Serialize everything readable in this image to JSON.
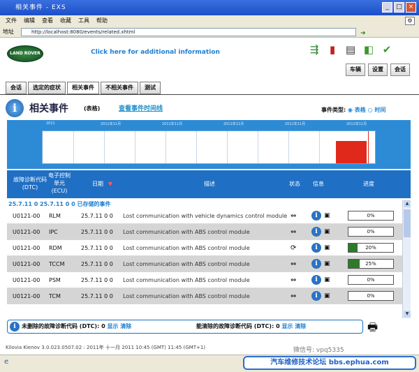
{
  "window": {
    "title": "相关事件 - EXS"
  },
  "menubar": {
    "items": [
      "文件",
      "编辑",
      "查看",
      "收藏",
      "工具",
      "帮助"
    ]
  },
  "address": {
    "label": "地址",
    "url": "http://localhost:8080/events/related.xhtml"
  },
  "header": {
    "logo_text": "LAND ROVER",
    "info_link": "Click here for additional information",
    "right_tabs": [
      "车辆",
      "设置",
      "会话"
    ]
  },
  "nav_tabs": [
    "会话",
    "选定的症状",
    "相关事件",
    "不相关事件",
    "测试"
  ],
  "page": {
    "title": "相关事件",
    "subtitle": "(表格)",
    "timeline_link": "查看事件时间线",
    "event_type_label": "事件类型:",
    "event_type_opt1": "表格",
    "event_type_opt2": "时间"
  },
  "timeline": {
    "ticks": [
      "2011",
      "2011年11月",
      "2011年11月",
      "2011年11月",
      "2011年11月",
      "2011年11月"
    ]
  },
  "table": {
    "headers": {
      "dtc": "故障诊断代码 (DTC)",
      "module": "电子控制单元 (ECU)",
      "date": "日期",
      "desc": "描述",
      "state": "状态",
      "info": "信息",
      "progress": "进度"
    },
    "group_label": "25.7.11 0  25.7.11 0 0   已存储的事件",
    "rows": [
      {
        "dtc": "U0121-00",
        "module": "RLM",
        "date": "25.7.11 0 0",
        "desc": "Lost communication with vehicle dynamics control module",
        "state": "⇔",
        "progress": "0%",
        "progress_value": 0
      },
      {
        "dtc": "U0121-00",
        "module": "IPC",
        "date": "25.7.11 0 0",
        "desc": "Lost communication with ABS control module",
        "state": "⇔",
        "progress": "0%",
        "progress_value": 0
      },
      {
        "dtc": "U0121-00",
        "module": "RDM",
        "date": "25.7.11 0 0",
        "desc": "Lost communication with ABS control module",
        "state": "⟳",
        "progress": "20%",
        "progress_value": 20
      },
      {
        "dtc": "U0121-00",
        "module": "TCCM",
        "date": "25.7.11 0 0",
        "desc": "Lost communication with ABS control module",
        "state": "⇔",
        "progress": "25%",
        "progress_value": 25
      },
      {
        "dtc": "U0121-00",
        "module": "PSM",
        "date": "25.7.11 0 0",
        "desc": "Lost communication with ABS control module",
        "state": "⇔",
        "progress": "0%",
        "progress_value": 0
      },
      {
        "dtc": "U0121-00",
        "module": "TCM",
        "date": "25.7.11 0 0",
        "desc": "Lost communication with ABS control module",
        "state": "⇔",
        "progress": "0%",
        "progress_value": 0
      }
    ]
  },
  "footer": {
    "seg1_label": "未删除的故障诊断代码 (DTC):",
    "seg1_value": "0",
    "show": "显示",
    "clear": "清除",
    "seg2_label": "能清除的故障诊断代码 (DTC):",
    "seg2_value": "0"
  },
  "statusline": "Kilovia Kienov 3.0.023.0507.02 : 2011年 十一月 2011 10:45 (GMT) 11:45 (GMT+1)",
  "watermark": "微信号: vpq5335",
  "banner": "汽车维修技术论坛 bbs.ephua.com"
}
